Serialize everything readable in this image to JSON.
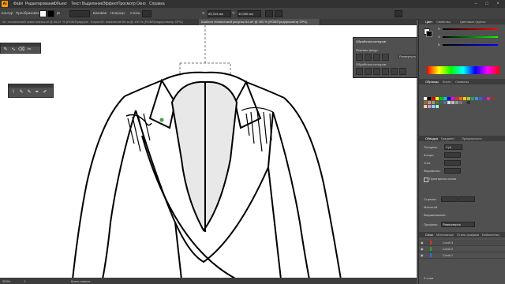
{
  "menubar": {
    "logo": "Ai",
    "items": [
      "Файл",
      "Редактирование",
      "Объект",
      "Текст",
      "Выделение",
      "Эффект",
      "Просмотр",
      "Окно",
      "Справка"
    ]
  },
  "controlbar": {
    "no_selection": "Контур",
    "transform_label": "Преобразовать",
    "brush_label": "Базовая",
    "style_label": "Стиль",
    "opacity_label": "Непрозр.",
    "x_value": "85,344 мм",
    "y_value": "44,966 мм"
  },
  "tabs": [
    {
      "label": "90. технический эскиз платья.ai @ 66,67 % (RGB/Предпросмотр GPU)",
      "active": false
    },
    {
      "label": "Блуза 09. изменение бл.ai @ 100 % (RGB/Предпросмотр GPU)",
      "active": false
    },
    {
      "label": "Шаблон технический рисунок А4.ai* @ 300 % (RGB/Предпросмотр GPU)",
      "active": true
    }
  ],
  "status": {
    "zoom": "300%",
    "page": "1",
    "tool": "Кисть-клякса"
  },
  "pathfinder": {
    "title": "Обработка контуров",
    "shape_modes": "Режимы фигур:",
    "pathfinders": "Обработка контуров:",
    "expand": "Развернуть"
  },
  "right_panel": {
    "color_tabs": [
      "Цвет",
      "Свойства",
      "Цветовые группы"
    ],
    "rgb": [
      "R",
      "G",
      "B"
    ],
    "swatch_tabs": [
      "Образцы",
      "Кисти",
      "Символы"
    ],
    "stroke_tabs": [
      "Обводка",
      "Градиент",
      "Прозрачность"
    ],
    "stroke": {
      "weight_label": "Толщина:",
      "weight_value": "1 pt",
      "cap_label": "Концы:",
      "corner_label": "Угол:",
      "align_label": "Выровнять:",
      "dashed_label": "Пунктирная линия",
      "arrows_label": "Стрелки:",
      "scale_label": "Масштаб:",
      "align2_label": "Выравнивание:",
      "profile_label": "Профиль:",
      "profile_value": "Равномерно"
    },
    "layer_tabs": [
      "Слои",
      "Монтажные",
      "Стили графики",
      "Библиотеки"
    ],
    "layers": [
      "Слой 3",
      "Слой 2",
      "Слой 1"
    ],
    "layers_count": "3 слоя"
  },
  "colors": {
    "accent": "#ff9a00",
    "panel": "#505050",
    "menubar": "#323232",
    "canvas": "#ffffff",
    "sketch_fill": "#e8e8e8",
    "highlight": "#46a046"
  }
}
